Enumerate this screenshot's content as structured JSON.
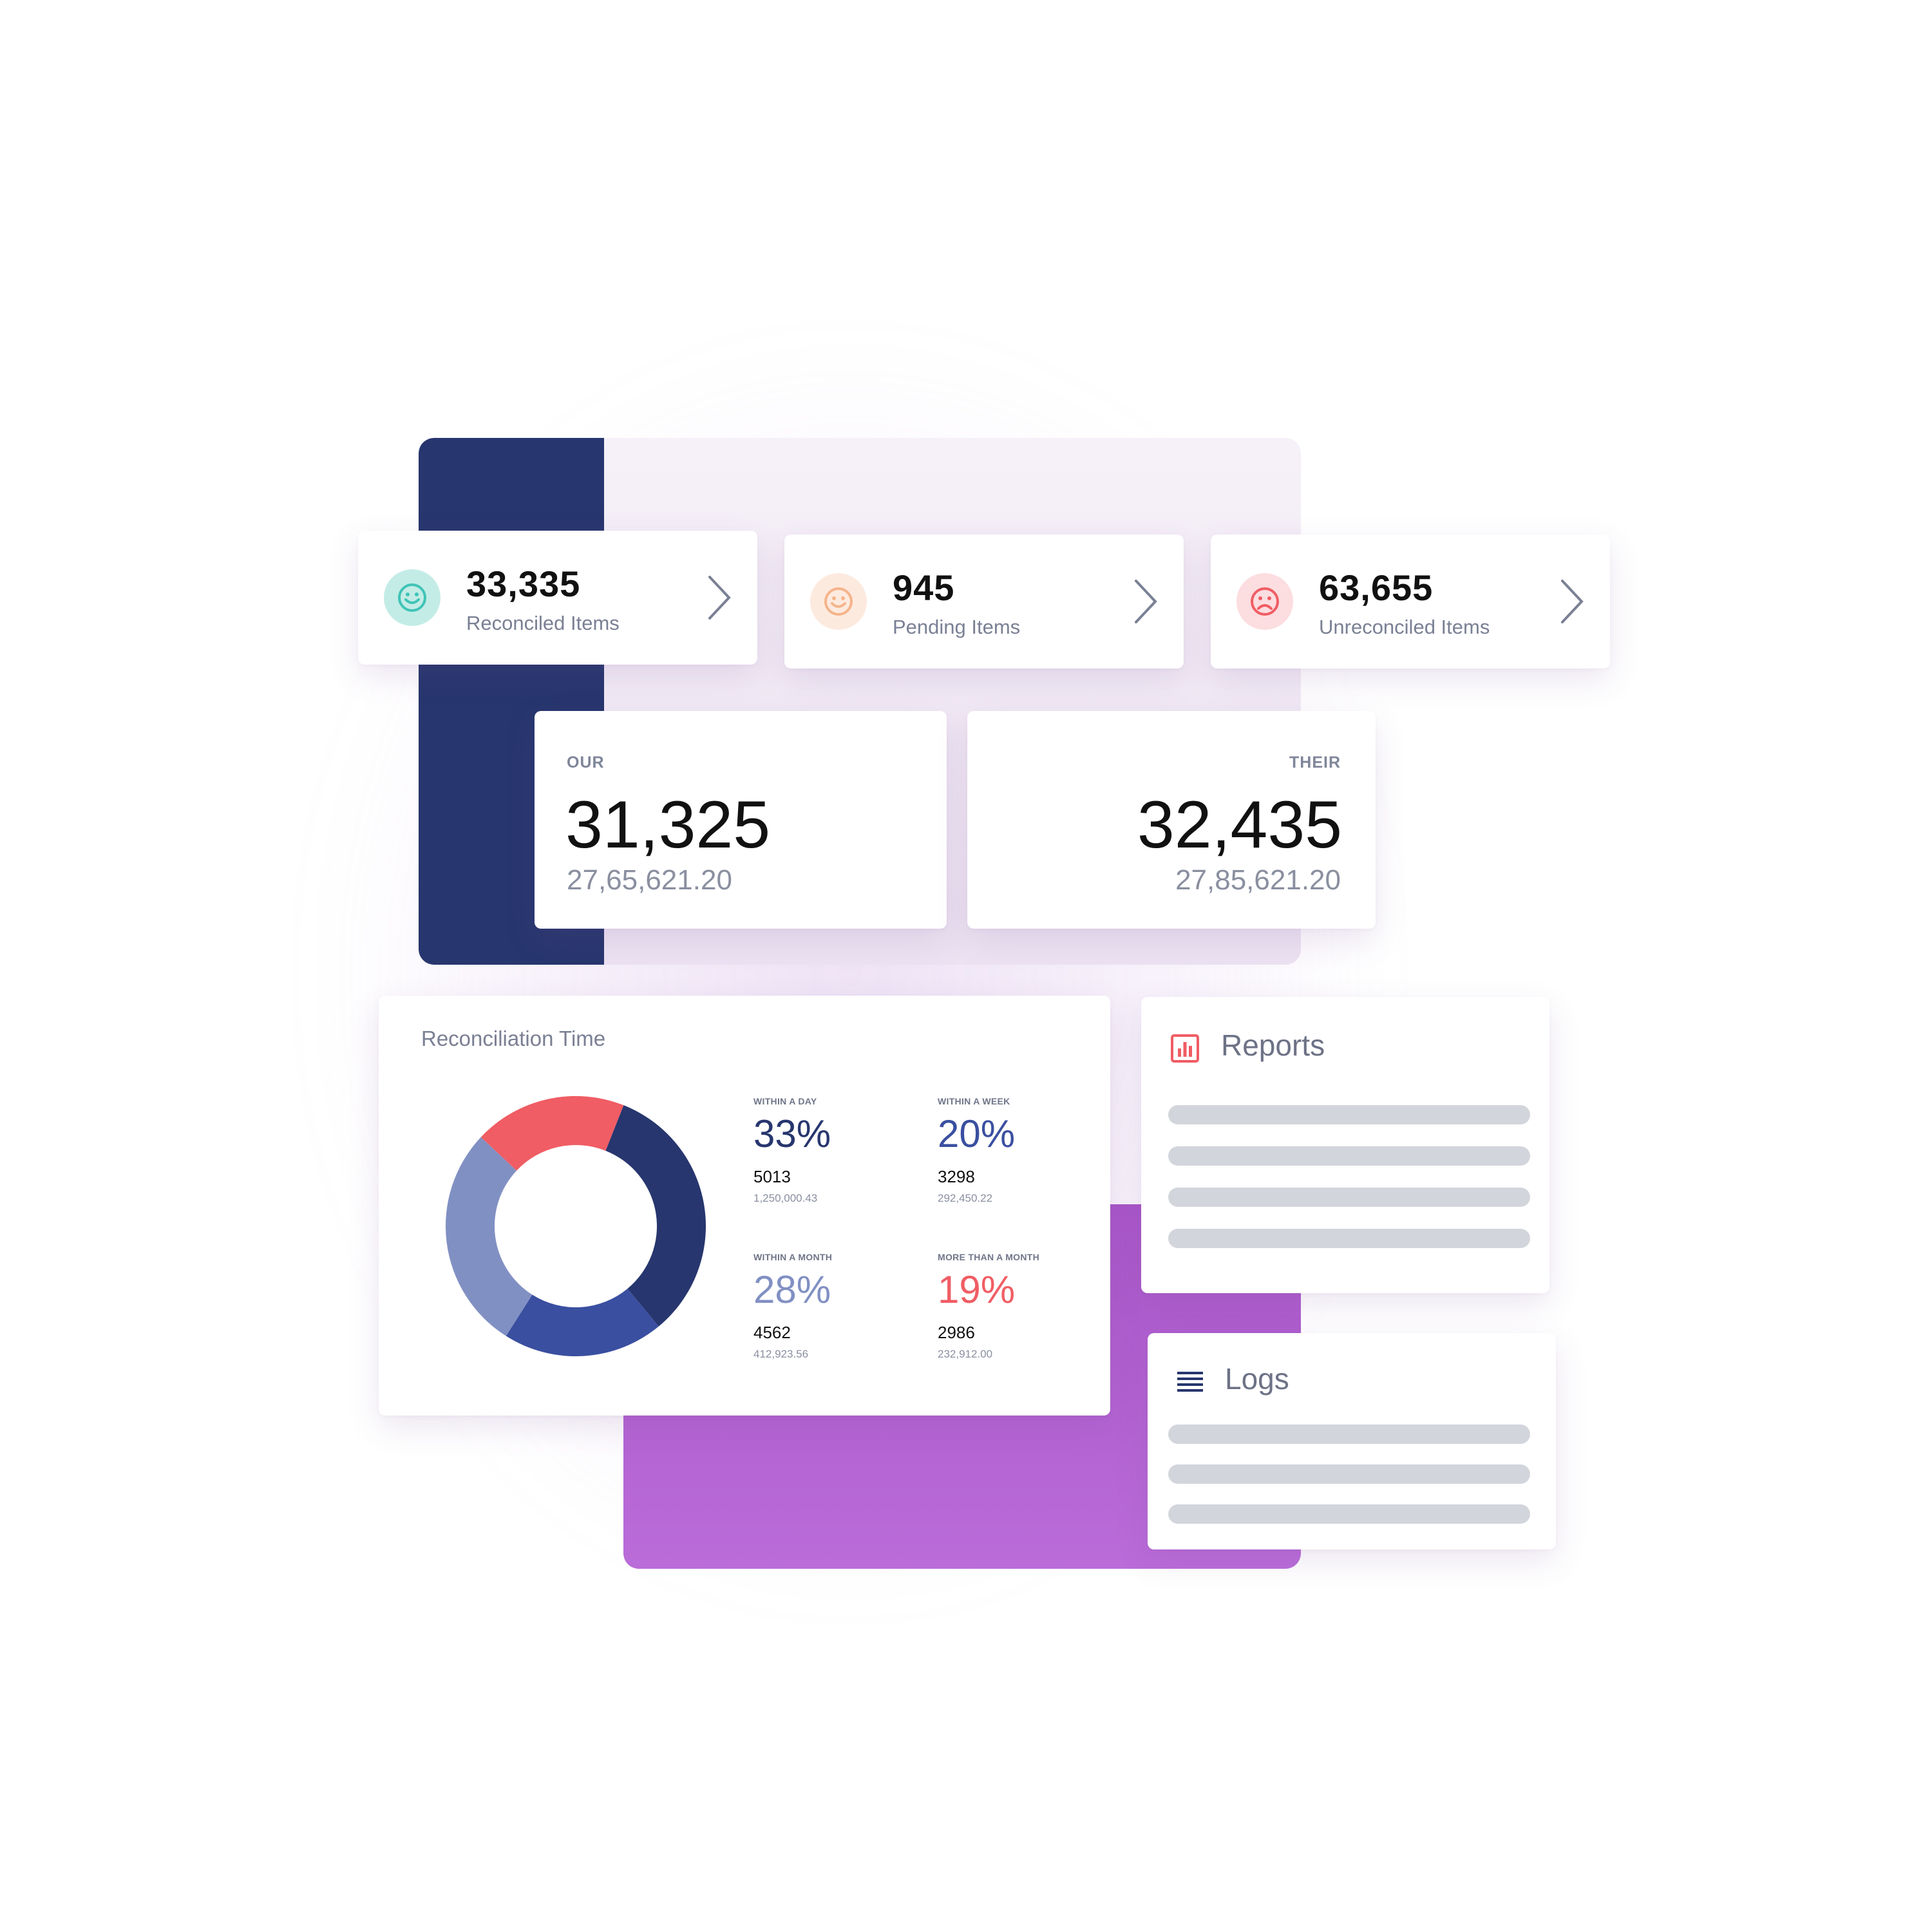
{
  "colors": {
    "navy": "#27366e",
    "royal_blue": "#3a4fa0",
    "periwinkle": "#8190c3",
    "coral": "#f05d64",
    "teal": "#3fc4b6",
    "peach": "#f5b48a",
    "purple": "#b065d3"
  },
  "status_cards": [
    {
      "count": "33,335",
      "label": "Reconciled Items",
      "icon": "smile-icon"
    },
    {
      "count": "945",
      "label": "Pending Items",
      "icon": "smile-icon"
    },
    {
      "count": "63,655",
      "label": "Unreconciled Items",
      "icon": "frown-icon"
    }
  ],
  "totals": {
    "our": {
      "label": "OUR",
      "count": "31,325",
      "amount": "27,65,621.20"
    },
    "their": {
      "label": "THEIR",
      "count": "32,435",
      "amount": "27,85,621.20"
    }
  },
  "reconciliation": {
    "title": "Reconciliation Time",
    "stats": [
      {
        "caption": "WITHIN A DAY",
        "percent": "33%",
        "count": "5013",
        "amount": "1,250,000.43"
      },
      {
        "caption": "WITHIN A WEEK",
        "percent": "20%",
        "count": "3298",
        "amount": "292,450.22"
      },
      {
        "caption": "WITHIN A MONTH",
        "percent": "28%",
        "count": "4562",
        "amount": "412,923.56"
      },
      {
        "caption": "MORE THAN A MONTH",
        "percent": "19%",
        "count": "2986",
        "amount": "232,912.00"
      }
    ]
  },
  "chart_data": {
    "type": "pie",
    "categories": [
      "WITHIN A DAY",
      "WITHIN A WEEK",
      "WITHIN A MONTH",
      "MORE THAN A MONTH"
    ],
    "values": [
      33,
      20,
      28,
      19
    ],
    "colors": [
      "#27366e",
      "#3a4fa0",
      "#8190c3",
      "#f05d64"
    ],
    "title": "Reconciliation Time",
    "donut": true
  },
  "reports": {
    "title": "Reports",
    "icon": "bar-chart-icon"
  },
  "logs": {
    "title": "Logs",
    "icon": "list-icon"
  }
}
